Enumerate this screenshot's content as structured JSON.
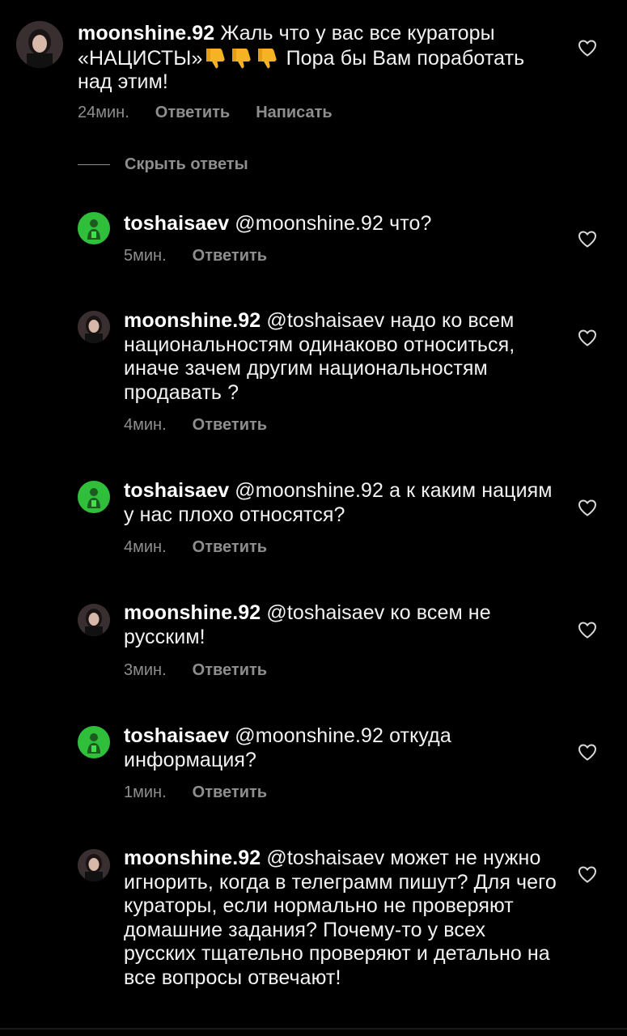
{
  "main_comment": {
    "username": "moonshine.92",
    "text_part1": "Жаль что у вас все кураторы «НАЦИСТЫ»",
    "text_part2": " Пора бы Вам поработать над этим!",
    "emoji_count": 3,
    "time": "24мин.",
    "reply_label": "Ответить",
    "message_label": "Написать"
  },
  "hide_replies_label": "Скрыть ответы",
  "replies": [
    {
      "username": "toshaisaev",
      "mention": "@moonshine.92",
      "text": " что?",
      "time": "5мин.",
      "reply_label": "Ответить",
      "avatar": "green"
    },
    {
      "username": "moonshine.92",
      "mention": "@toshaisaev",
      "text": " надо ко всем национальностям одинаково относиться, иначе зачем другим национальностям продавать ?",
      "time": "4мин.",
      "reply_label": "Ответить",
      "avatar": "girl"
    },
    {
      "username": "toshaisaev",
      "mention": "@moonshine.92",
      "text": " а к каким нациям у нас плохо относятся?",
      "time": "4мин.",
      "reply_label": "Ответить",
      "avatar": "green"
    },
    {
      "username": "moonshine.92",
      "mention": "@toshaisaev",
      "text": " ко всем не русским!",
      "time": "3мин.",
      "reply_label": "Ответить",
      "avatar": "girl"
    },
    {
      "username": "toshaisaev",
      "mention": "@moonshine.92",
      "text": " откуда информация?",
      "time": "1мин.",
      "reply_label": "Ответить",
      "avatar": "green"
    },
    {
      "username": "moonshine.92",
      "mention": "@toshaisaev",
      "text": " может не нужно игнорить, когда в телеграмм пишут? Для чего кураторы, если нормально не проверяют домашние задания? Почему-то у всех русских тщательно проверяют и детально на все вопросы отвечают!",
      "avatar": "girl"
    }
  ]
}
